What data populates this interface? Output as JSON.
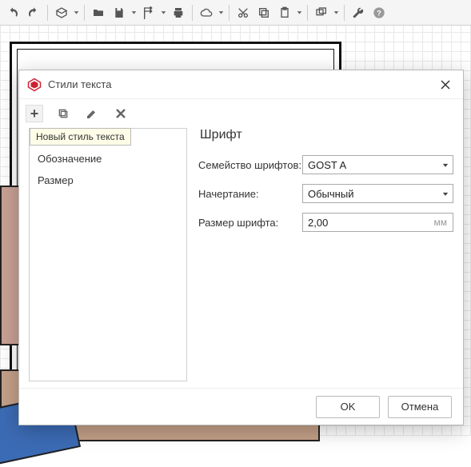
{
  "toolbar": {
    "icons": [
      "undo",
      "redo",
      "box",
      "open",
      "save",
      "export",
      "print",
      "cloud",
      "cut",
      "copy",
      "paste",
      "windows",
      "wrench",
      "help"
    ]
  },
  "dialog": {
    "title": "Стили текста",
    "tooltip": "Новый стиль текста",
    "list": {
      "items": [
        "Обозначение",
        "Размер"
      ]
    },
    "section_title": "Шрифт",
    "fields": {
      "family": {
        "label": "Семейство шрифтов:",
        "value": "GOST A"
      },
      "style": {
        "label": "Начертание:",
        "value": "Обычный"
      },
      "size": {
        "label": "Размер шрифта:",
        "value": "2,00",
        "unit": "мм"
      }
    },
    "buttons": {
      "ok": "OK",
      "cancel": "Отмена"
    }
  }
}
